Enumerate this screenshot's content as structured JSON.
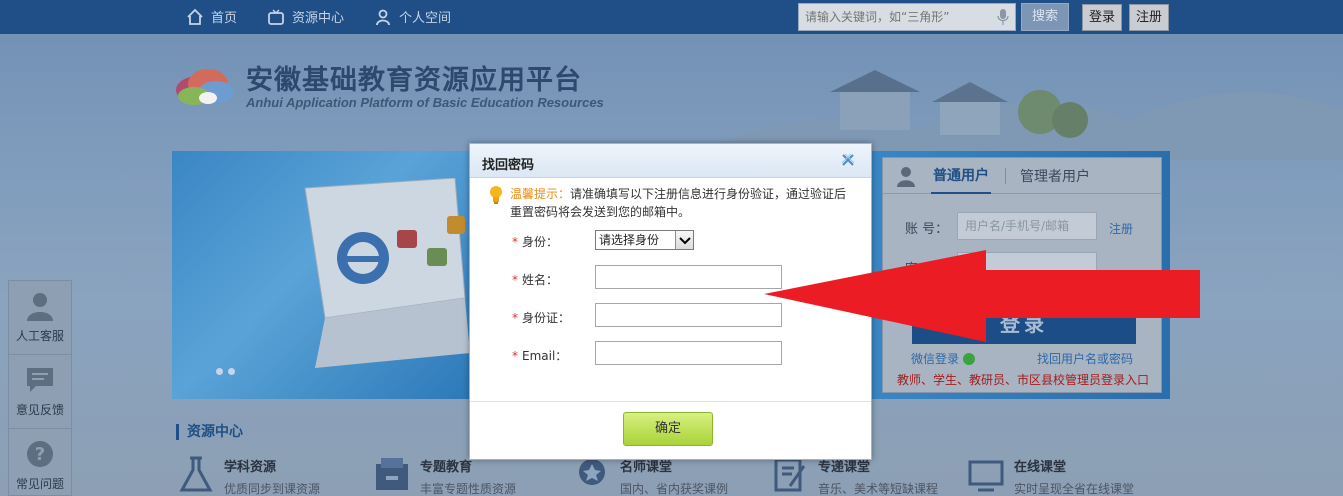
{
  "topbar": {
    "nav": [
      {
        "label": "首页",
        "icon": "home-icon"
      },
      {
        "label": "资源中心",
        "icon": "tv-icon"
      },
      {
        "label": "个人空间",
        "icon": "person-icon"
      }
    ],
    "search_placeholder": "请输入关键词，如“三角形”",
    "search_label": "搜索",
    "login_label": "登录",
    "register_label": "注册"
  },
  "logo": {
    "cn": "安徽基础教育资源应用平台",
    "en": "Anhui Application Platform of Basic Education Resources"
  },
  "login_panel": {
    "tab_active": "普通用户",
    "tab_other": "管理者用户",
    "account_label": "账  号：",
    "account_placeholder": "用户名/手机号/邮箱",
    "register_link": "注册",
    "password_label": "密  码：",
    "login_button": "登录",
    "wechat_login": "微信登录",
    "find_link": "找回用户名或密码",
    "notice": "教师、学生、教研员、市区县校管理员登录入口"
  },
  "side_tools": [
    {
      "label": "人工客服",
      "icon": "agent-icon"
    },
    {
      "label": "意见反馈",
      "icon": "feedback-icon"
    },
    {
      "label": "常见问题",
      "icon": "question-icon"
    }
  ],
  "resource_center": {
    "title": "资源中心",
    "items": [
      {
        "title": "学科资源",
        "sub": "优质同步到课资源"
      },
      {
        "title": "专题教育",
        "sub": "丰富专题性质资源"
      },
      {
        "title": "名师课堂",
        "sub": "国内、省内获奖课例"
      },
      {
        "title": "专递课堂",
        "sub": "音乐、美术等短缺课程"
      },
      {
        "title": "在线课堂",
        "sub": "实时呈现全省在线课堂"
      }
    ]
  },
  "modal": {
    "title": "找回密码",
    "tip_label": "温馨提示：",
    "tip_text1": "请准确填写以下注册信息进行身份验证，通过验证后",
    "tip_text2": "重置密码将会发送到您的邮箱中。",
    "identity_label": "身份：",
    "identity_value": "请选择身份",
    "name_label": "姓名：",
    "id_label": "身份证：",
    "email_label": "Email：",
    "required_mark": "*",
    "confirm_label": "确定"
  },
  "colors": {
    "topbar": "#1f4f86",
    "modal_header": "#dbe7f4",
    "confirm_button": "#a8d33a",
    "tip_highlight": "#e98b12",
    "required": "#d33333",
    "annotation_arrow": "#ec1c24"
  }
}
